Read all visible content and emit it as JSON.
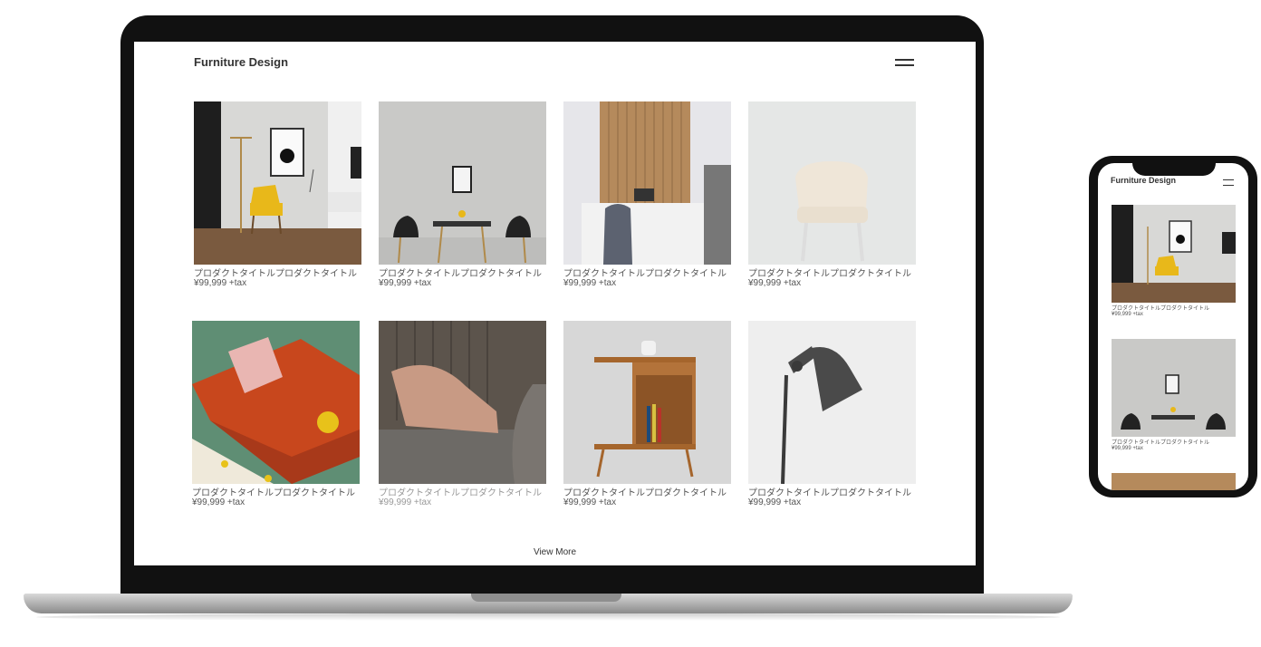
{
  "laptop": {
    "site_title": "Furniture Design",
    "view_more": "View More",
    "products": [
      {
        "name": "プロダクトタイトルプロダクトタイトル",
        "price": "¥99,999 +tax",
        "image": "living-room-yellow-chair"
      },
      {
        "name": "プロダクトタイトルプロダクトタイトル",
        "price": "¥99,999 +tax",
        "image": "dining-table-black-chairs"
      },
      {
        "name": "プロダクトタイトルプロダクトタイトル",
        "price": "¥99,999 +tax",
        "image": "desk-wood-panel"
      },
      {
        "name": "プロダクトタイトルプロダクトタイトル",
        "price": "¥99,999 +tax",
        "image": "white-tufted-chair"
      },
      {
        "name": "プロダクトタイトルプロダクトタイトル",
        "price": "¥99,999 +tax",
        "image": "orange-sofa"
      },
      {
        "name": "プロダクトタイトルプロダクトタイトル",
        "price": "¥99,999 +tax",
        "image": "pink-lounge-chair"
      },
      {
        "name": "プロダクトタイトルプロダクトタイトル",
        "price": "¥99,999 +tax",
        "image": "wood-side-table"
      },
      {
        "name": "プロダクトタイトルプロダクトタイトル",
        "price": "¥99,999 +tax",
        "image": "black-floor-lamp"
      }
    ]
  },
  "phone": {
    "site_title": "Furniture Design",
    "products": [
      {
        "name": "プロダクトタイトルプロダクトタイトル",
        "price": "¥99,999 +tax"
      },
      {
        "name": "プロダクトタイトルプロダクトタイトル",
        "price": "¥99,999 +tax"
      }
    ]
  },
  "colors": {
    "device_frame": "#111111",
    "text": "#333333",
    "muted_text": "#555555",
    "accent_yellow": "#e8b81a",
    "sofa_orange": "#c8471d"
  }
}
